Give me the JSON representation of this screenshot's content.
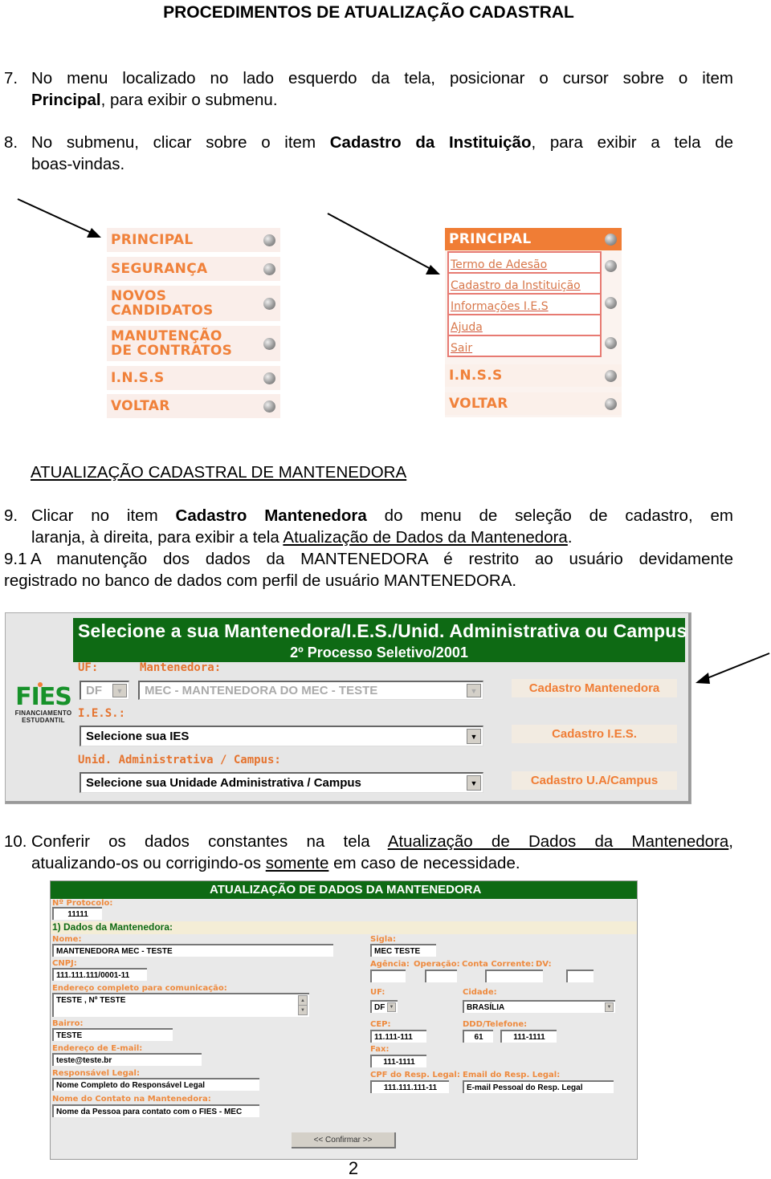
{
  "title": "PROCEDIMENTOS DE ATUALIZAÇÃO CADASTRAL",
  "steps": {
    "s7": {
      "num": "7.",
      "line1": "No menu localizado no lado esquerdo da tela, posicionar o cursor sobre o item",
      "bold": "Principal",
      "line2_rest": ", para exibir o submenu."
    },
    "s8": {
      "num": "8.",
      "pre": "No submenu, clicar sobre o item ",
      "bold": "Cadastro da Instituição",
      "post": ", para exibir a tela de",
      "line2": "boas-vindas."
    },
    "section_heading": "ATUALIZAÇÃO CADASTRAL DE MANTENEDORA",
    "s9": {
      "num": "9.",
      "pre": "Clicar no item ",
      "bold": "Cadastro Mantenedora",
      "post": " do menu de seleção de cadastro, em",
      "line2_pre": "laranja, à direita, para exibir a tela ",
      "line2_link": "Atualização de Dados da Mantenedora",
      "line2_post": "."
    },
    "s91": {
      "num": "9.1",
      "line1": "A manutenção dos dados da MANTENEDORA é restrito ao usuário devidamente",
      "line2": "registrado no banco de dados com perfil de usuário MANTENEDORA."
    },
    "s10": {
      "num": "10.",
      "pre": "Conferir os dados constantes na tela ",
      "link": "Atualização de Dados da Mantenedora",
      "post": ",",
      "line2_pre": "atualizando-os ou corrigindo-os ",
      "line2_u": "somente",
      "line2_post": " em caso de necessidade."
    }
  },
  "menu_left": {
    "items": [
      "PRINCIPAL",
      "SEGURANÇA",
      "NOVOS CANDIDATOS",
      "MANUTENÇÃO DE CONTRATOS",
      "I.N.S.S",
      "VOLTAR"
    ]
  },
  "menu_right": {
    "head": "PRINCIPAL",
    "submenu": [
      "Termo de Adesão",
      "Cadastro da Instituição",
      "Informações I.E.S",
      "Ajuda",
      "Sair"
    ],
    "items": [
      "I.N.S.S",
      "VOLTAR"
    ]
  },
  "screen_select": {
    "title": "Selecione a sua Mantenedora/I.E.S./Unid. Administrativa ou Campus",
    "subtitle": "2º Processo Seletivo/2001",
    "logo": {
      "name": "FIES",
      "line1": "FINANCIAMENTO",
      "line2": "ESTUDANTIL"
    },
    "uf_label": "UF:",
    "uf_value": "DF",
    "mantenedora_label": "Mantenedora:",
    "mantenedora_value": "MEC - MANTENEDORA DO MEC - TESTE",
    "ies_label": "I.E.S.:",
    "ies_value": "Selecione sua IES",
    "ua_label": "Unid. Administrativa / Campus:",
    "ua_value": "Selecione sua Unidade Administrativa / Campus",
    "links": [
      "Cadastro Mantenedora",
      "Cadastro I.E.S.",
      "Cadastro U.A/Campus"
    ]
  },
  "screen_update": {
    "title": "ATUALIZAÇÃO DE DADOS DA MANTENEDORA",
    "protocolo_label": "Nº Protocolo:",
    "protocolo": "11111",
    "section": "1) Dados da Mantenedora:",
    "fields": {
      "nome": {
        "label": "Nome:",
        "value": "MANTENEDORA MEC - TESTE"
      },
      "sigla": {
        "label": "Sigla:",
        "value": "MEC TESTE"
      },
      "cnpj": {
        "label": "CNPJ:",
        "value": "111.111.111/0001-11"
      },
      "agencia": {
        "label": "Agência:",
        "value": ""
      },
      "operacao": {
        "label": "Operação:",
        "value": ""
      },
      "conta": {
        "label": "Conta Corrente:",
        "value": ""
      },
      "dv": {
        "label": "DV:",
        "value": ""
      },
      "endereco": {
        "label": "Endereço completo para comunicação:",
        "value": "TESTE , Nº TESTE"
      },
      "uf": {
        "label": "UF:",
        "value": "DF"
      },
      "cidade": {
        "label": "Cidade:",
        "value": "BRASÍLIA"
      },
      "bairro": {
        "label": "Bairro:",
        "value": "TESTE"
      },
      "cep": {
        "label": "CEP:",
        "value": "11.111-111"
      },
      "ddd_tel": {
        "label": "DDD/Telefone:",
        "ddd": "61",
        "tel": "111-1111"
      },
      "email": {
        "label": "Endereço de E-mail:",
        "value": "teste@teste.br"
      },
      "fax": {
        "label": "Fax:",
        "value": "111-1111"
      },
      "resp": {
        "label": "Responsável Legal:",
        "value": "Nome Completo do Responsável Legal"
      },
      "cpf": {
        "label": "CPF do Resp. Legal:",
        "value": "111.111.111-11"
      },
      "email_resp": {
        "label": "Email do Resp. Legal:",
        "value": "E-mail Pessoal do Resp. Legal"
      },
      "contato": {
        "label": "Nome do Contato na Mantenedora:",
        "value": "Nome da Pessoa para contato com o FIES - MEC"
      }
    },
    "confirm_label": "<< Confirmar >>"
  },
  "page_number": "2"
}
